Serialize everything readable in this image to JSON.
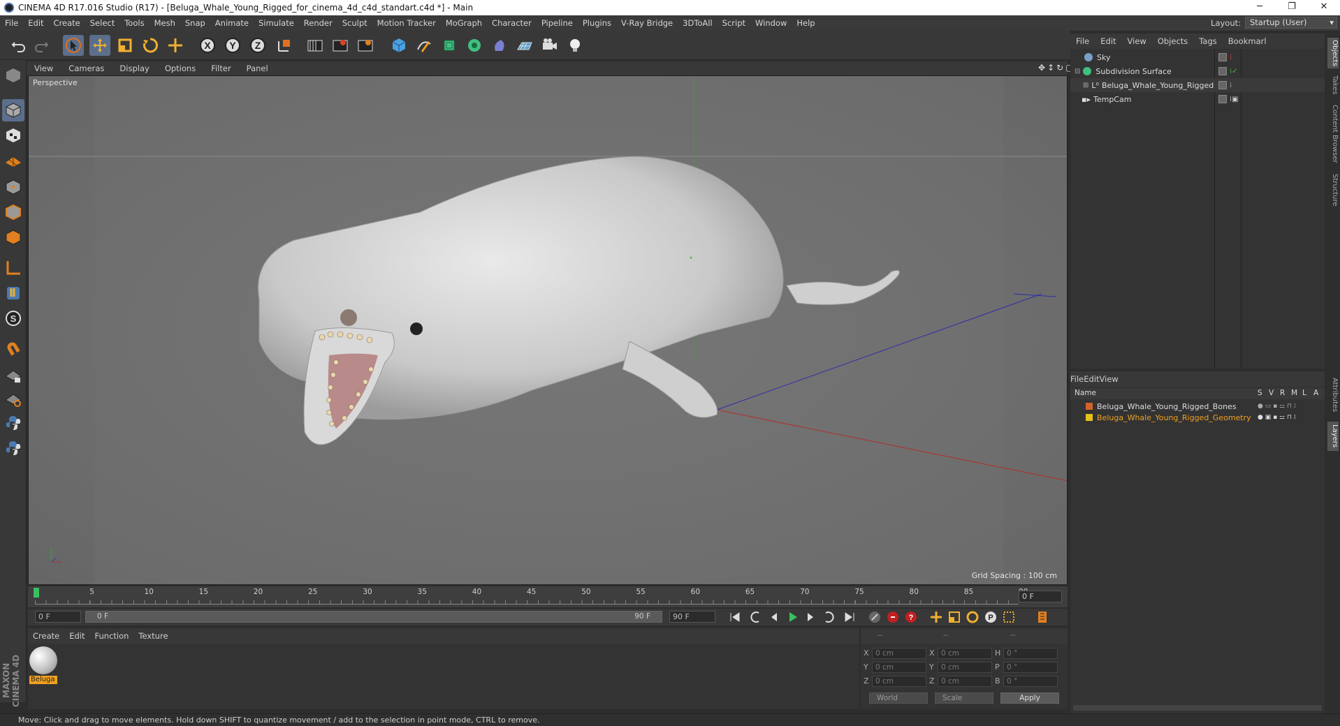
{
  "window": {
    "title": "CINEMA 4D R17.016 Studio (R17) - [Beluga_Whale_Young_Rigged_for_cinema_4d_c4d_standart.c4d *] - Main",
    "minimize": "─",
    "maximize": "❐",
    "close": "✕"
  },
  "menubar": [
    "File",
    "Edit",
    "Create",
    "Select",
    "Tools",
    "Mesh",
    "Snap",
    "Animate",
    "Simulate",
    "Render",
    "Sculpt",
    "Motion Tracker",
    "MoGraph",
    "Character",
    "Pipeline",
    "Plugins",
    "V-Ray Bridge",
    "3DToAll",
    "Script",
    "Window",
    "Help"
  ],
  "layout": {
    "label": "Layout:",
    "value": "Startup (User)"
  },
  "toolbar_icons": [
    "undo-icon",
    "redo-icon",
    "select-arrow-icon",
    "move-icon",
    "scale-icon",
    "rotate-icon",
    "transform-icon",
    "x-axis-icon",
    "y-axis-icon",
    "z-axis-icon",
    "world-coord-icon",
    "render-view-icon",
    "render-picture-icon",
    "render-settings-icon",
    "cube-icon",
    "pen-spline-icon",
    "subdivision-icon",
    "array-icon",
    "deformer-icon",
    "floor-icon",
    "camera-icon",
    "light-icon"
  ],
  "axis_labels": [
    "X",
    "Y",
    "Z"
  ],
  "viewport": {
    "menu": [
      "View",
      "Cameras",
      "Display",
      "Options",
      "Filter",
      "Panel"
    ],
    "label": "Perspective",
    "grid_spacing": "Grid Spacing : 100 cm"
  },
  "timeline": {
    "ticks": [
      "0",
      "5",
      "10",
      "15",
      "20",
      "25",
      "30",
      "35",
      "40",
      "45",
      "50",
      "55",
      "60",
      "65",
      "70",
      "75",
      "80",
      "85",
      "90"
    ],
    "current_frame": "0 F",
    "start_field": "0 F",
    "range_start": "0 F",
    "range_end": "90 F",
    "end_field": "90 F"
  },
  "material_manager": {
    "menu": [
      "Create",
      "Edit",
      "Function",
      "Texture"
    ],
    "materials": [
      {
        "name": "Beluga"
      }
    ]
  },
  "coordinates": {
    "headers": [
      "--",
      "--",
      "--"
    ],
    "rows": [
      {
        "a": "X",
        "a_val": "0 cm",
        "b": "X",
        "b_val": "0 cm",
        "c": "H",
        "c_val": "0 °"
      },
      {
        "a": "Y",
        "a_val": "0 cm",
        "b": "Y",
        "b_val": "0 cm",
        "c": "P",
        "c_val": "0 °"
      },
      {
        "a": "Z",
        "a_val": "0 cm",
        "b": "Z",
        "b_val": "0 cm",
        "c": "B",
        "c_val": "0 °"
      }
    ],
    "mode1": "World",
    "mode2": "Scale",
    "apply": "Apply"
  },
  "object_manager": {
    "menu": [
      "File",
      "Edit",
      "View",
      "Objects",
      "Tags",
      "Bookmarl"
    ],
    "objects": [
      {
        "name": "Sky"
      },
      {
        "name": "Subdivision Surface"
      },
      {
        "name": "Beluga_Whale_Young_Rigged"
      },
      {
        "name": "TempCam"
      }
    ]
  },
  "layer_manager": {
    "menu": [
      "File",
      "Edit",
      "View"
    ],
    "columns": [
      "Name",
      "S",
      "V",
      "R",
      "M",
      "L",
      "A"
    ],
    "layers": [
      {
        "name": "Beluga_Whale_Young_Rigged_Bones",
        "color": "#d4622a"
      },
      {
        "name": "Beluga_Whale_Young_Rigged_Geometry",
        "color": "#e3c21a"
      }
    ]
  },
  "right_tabs": [
    "Objects",
    "Takes",
    "Content Browser",
    "Structure",
    "Attributes",
    "Layers"
  ],
  "branding": "MAXON CINEMA 4D",
  "status": "Move: Click and drag to move elements. Hold down SHIFT to quantize movement / add to the selection in point mode, CTRL to remove.",
  "colors": {
    "accent": "#5b6f8c",
    "layer_selected_text": "#f0a020",
    "axis_x": "#c03030",
    "axis_y": "#30b030",
    "axis_z": "#3030c0"
  }
}
